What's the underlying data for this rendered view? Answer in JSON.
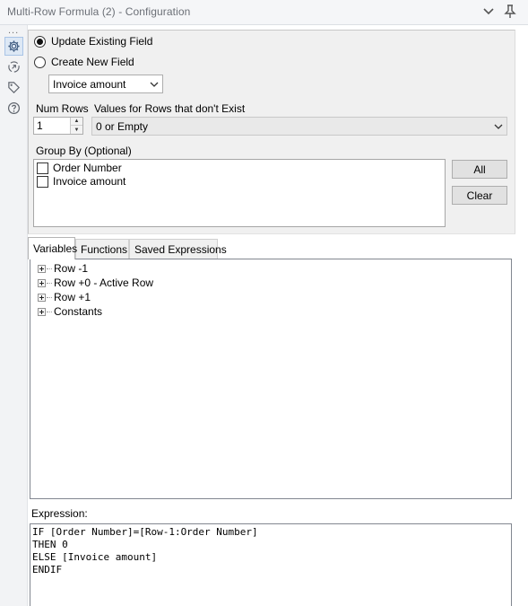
{
  "window": {
    "title": "Multi-Row Formula (2) - Configuration",
    "collapse_icon": "chevron-down-icon",
    "pin_icon": "pin-icon"
  },
  "sidebar": {
    "dots": "...",
    "icons": [
      "gear-icon",
      "connection-icon",
      "tag-icon",
      "help-icon"
    ]
  },
  "config": {
    "update_existing_label": "Update Existing Field",
    "create_new_label": "Create New  Field",
    "selected_mode": "update",
    "field_dropdown_value": "Invoice amount",
    "num_rows_label": "Num Rows",
    "num_rows_value": "1",
    "missing_rows_label": "Values for Rows that don't Exist",
    "missing_rows_value": "0 or Empty",
    "group_by_label": "Group By (Optional)",
    "group_by_items": [
      {
        "label": "Order Number",
        "checked": false
      },
      {
        "label": "Invoice amount",
        "checked": false
      }
    ],
    "all_button": "All",
    "clear_button": "Clear"
  },
  "tabs": [
    "Variables",
    "Functions",
    "Saved Expressions"
  ],
  "active_tab": "Variables",
  "variables_tree": [
    "Row -1",
    "Row +0 - Active Row",
    "Row +1",
    "Constants"
  ],
  "expression": {
    "label": "Expression:",
    "lines": [
      "IF [Order Number]=[Row-1:Order Number]",
      "THEN 0",
      "ELSE [Invoice amount]",
      "ENDIF"
    ]
  }
}
